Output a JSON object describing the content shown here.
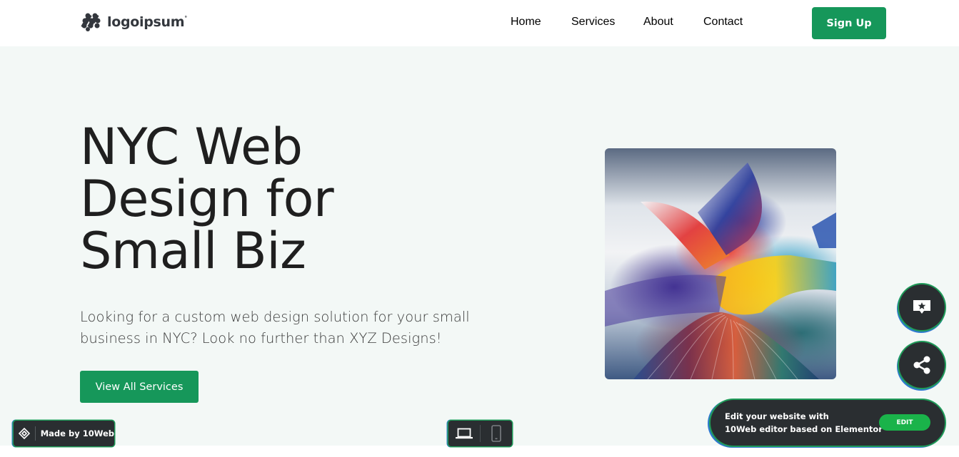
{
  "header": {
    "logo_text": "logoipsum",
    "logo_mark": "°",
    "nav": [
      {
        "label": "Home"
      },
      {
        "label": "Services"
      },
      {
        "label": "About"
      },
      {
        "label": "Contact"
      }
    ],
    "signup_label": "Sign Up"
  },
  "hero": {
    "title_lines": [
      "NYC Web",
      "Design for",
      "Small Biz"
    ],
    "description": "Looking for a custom web design solution for your small business in NYC? Look no further than XYZ Designs!",
    "cta_label": "View All Services",
    "image_alt": "abstract colorful ribbon artwork"
  },
  "floating": {
    "review_icon": "review-star-icon",
    "share_icon": "share-icon"
  },
  "editor_bar": {
    "line1": "Edit your website with",
    "line2": "10Web editor based on Elementor",
    "edit_label": "EDIT"
  },
  "made_by": {
    "label": "Made by 10Web"
  },
  "device_switch": {
    "desktop_icon": "laptop-icon",
    "mobile_icon": "mobile-icon"
  },
  "colors": {
    "brand_green": "#16975a",
    "hero_bg": "#f3f8f6",
    "dark_widget": "#2a2e31",
    "edit_green": "#1ab34a"
  }
}
